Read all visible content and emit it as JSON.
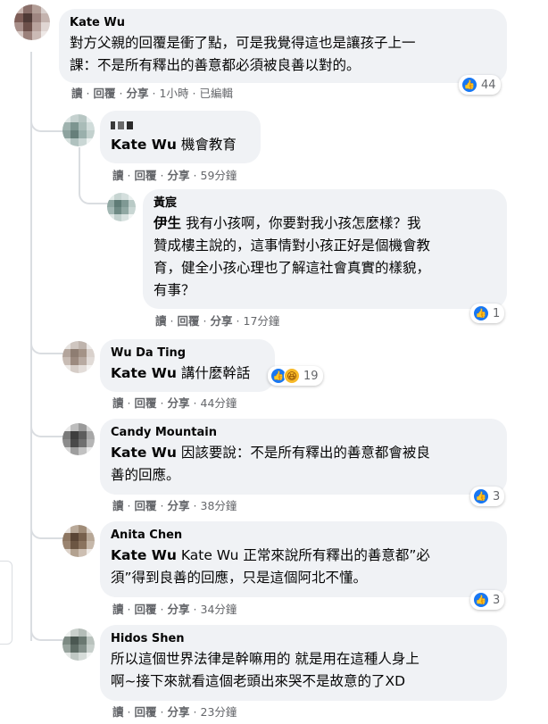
{
  "comments": [
    {
      "author": "Kate Wu",
      "text": "對方父親的回覆是衝了點，可是我覺得這也是讓孩子上一課：不是所有釋出的善意都必須被良善以對的。",
      "line1": "對方父親的回覆是衝了點，可是我覺得這也是讓孩子上一",
      "line2": "課：不是所有釋出的善意都必須被良善以對的。",
      "actions": {
        "read": "讀",
        "reply": "回覆",
        "share": "分享",
        "time": "1小時",
        "edited": "已編輯"
      },
      "reaction_count": "44"
    },
    {
      "author": "",
      "mention": "Kate Wu",
      "text": "機會教育",
      "actions": {
        "read": "讀",
        "reply": "回覆",
        "share": "分享",
        "time": "59分鐘"
      }
    },
    {
      "author": "黃宸",
      "mention": "伊生",
      "line1": "我有小孩啊，你要對我小孩怎麼樣？我",
      "line2": "贊成樓主說的，這事情對小孩正好是個機會教",
      "line3": "育，健全小孩心理也了解這社會真實的樣貌，",
      "line4": "有事？",
      "actions": {
        "read": "讀",
        "reply": "回覆",
        "share": "分享",
        "time": "17分鐘"
      },
      "reaction_count": "1"
    },
    {
      "author": "Wu Da Ting",
      "mention": "Kate Wu",
      "text": "講什麼幹話",
      "actions": {
        "read": "讀",
        "reply": "回覆",
        "share": "分享",
        "time": "44分鐘"
      },
      "reaction_count": "19"
    },
    {
      "author": "Candy Mountain",
      "mention": "Kate Wu",
      "line1": "因該要說：不是所有釋出的善意都會被良",
      "line2": "善的回應。",
      "actions": {
        "read": "讀",
        "reply": "回覆",
        "share": "分享",
        "time": "38分鐘"
      },
      "reaction_count": "3"
    },
    {
      "author": "Anita Chen",
      "mention": "Kate Wu",
      "line1": "Kate Wu 正常來說所有釋出的善意都”必",
      "line2": "須”得到良善的回應，只是這個阿北不懂。",
      "actions": {
        "read": "讀",
        "reply": "回覆",
        "share": "分享",
        "time": "34分鐘"
      },
      "reaction_count": "3"
    },
    {
      "author": "Hidos Shen",
      "line1": "所以這個世界法律是幹嘛用的 就是用在這種人身上",
      "line2": "啊~接下來就看這個老頭出來哭不是故意的了XD",
      "actions": {
        "read": "讀",
        "reply": "回覆",
        "share": "分享",
        "time": "23分鐘"
      }
    }
  ],
  "icons": {
    "like": "thumbs-up-icon",
    "haha": "laughing-face-icon"
  },
  "colors": {
    "bubble": "#f0f2f5",
    "like": "#1877f2",
    "haha": "#f7b928",
    "meta": "#65676b"
  }
}
